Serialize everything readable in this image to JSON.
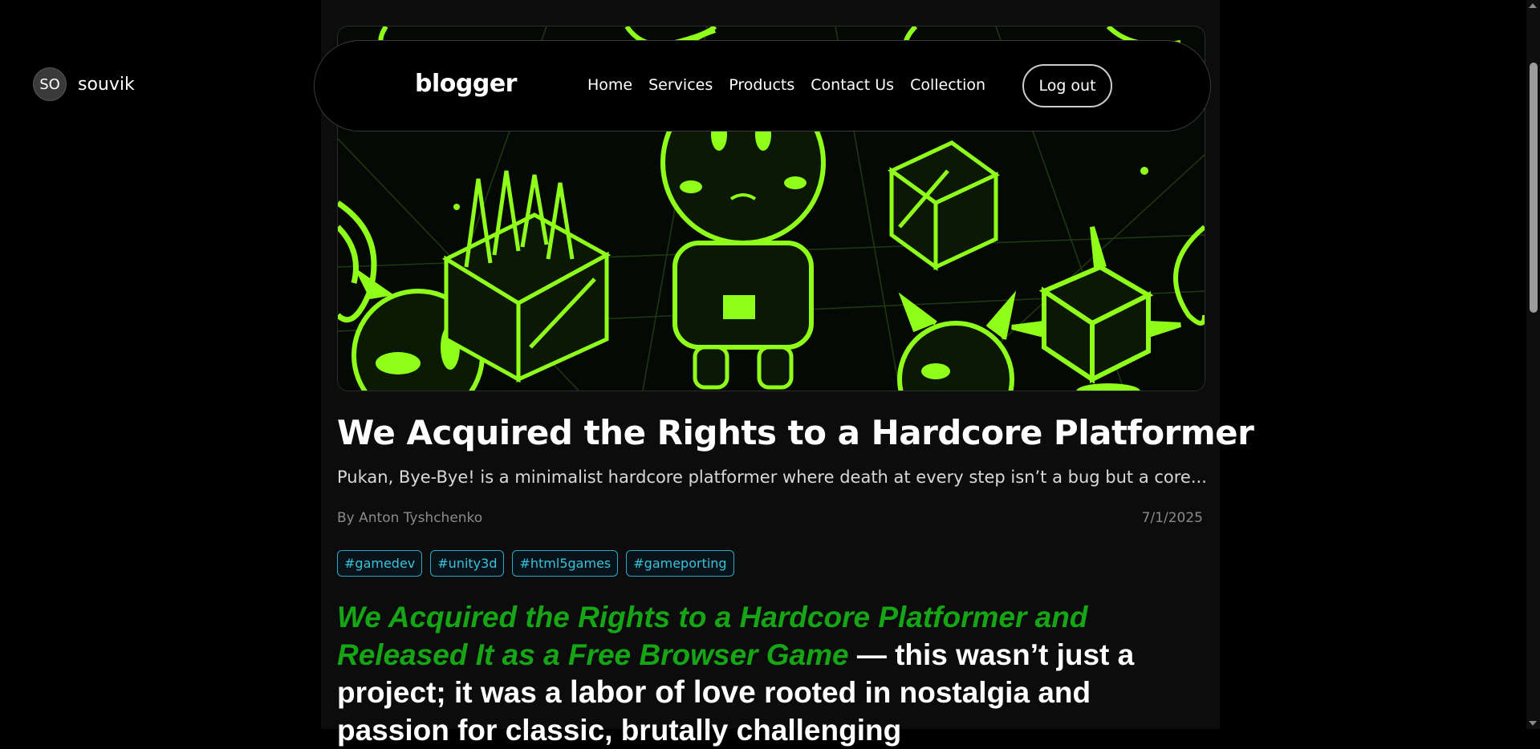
{
  "user": {
    "initials": "SO",
    "name": "souvik"
  },
  "navbar": {
    "logo": "blogger",
    "links": [
      "Home",
      "Services",
      "Products",
      "Contact Us",
      "Collection"
    ],
    "logout_label": "Log out"
  },
  "article": {
    "title": "We Acquired the Rights to a Hardcore Platformer",
    "excerpt": "Pukan, Bye-Bye! is a minimalist hardcore platformer where death at every step isn’t a bug but a core...",
    "author": "By Anton Tyshchenko",
    "date": "7/1/2025",
    "tags": [
      "#gamedev",
      "#unity3d",
      "#html5games",
      "#gameporting"
    ],
    "body": {
      "highlight": "We Acquired the Rights to a Hardcore Platformer and Released It as a Free Browser Game",
      "text1": " — this wasn’t just a project; it was a ",
      "emphasis": "labor of love",
      "text2": " rooted in nostalgia and passion for classic, brutally challenging"
    }
  },
  "colors": {
    "accent_green": "#15a515",
    "tag_cyan": "#38c2de",
    "hero_neon": "#8fff1a"
  },
  "hero_image": {
    "icons": [
      "monster-icon",
      "spike-cube-icon",
      "character-icon",
      "cube-icon"
    ]
  }
}
